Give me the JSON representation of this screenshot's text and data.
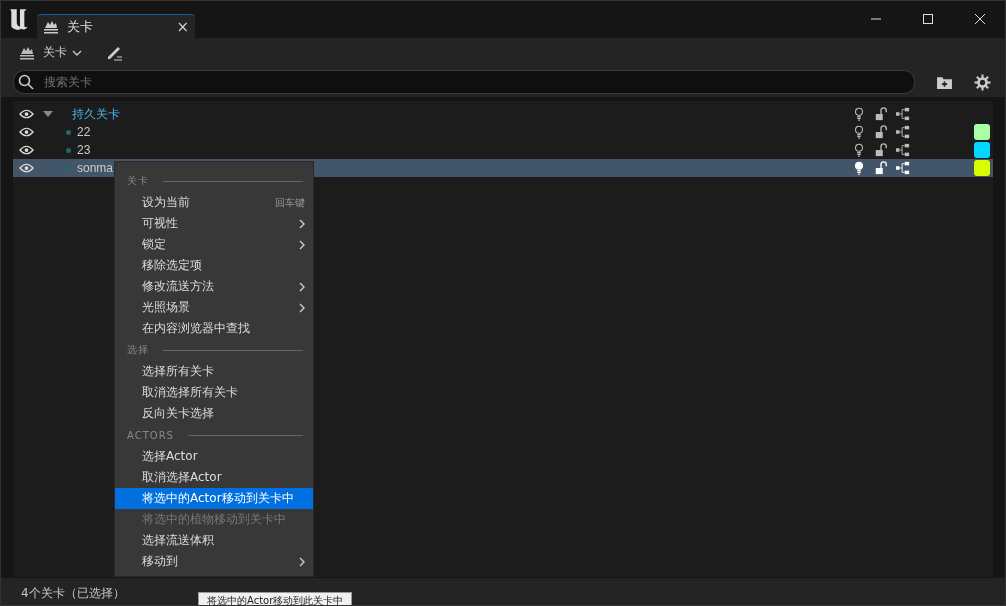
{
  "window": {
    "tab": {
      "title": "关卡",
      "close": "×"
    }
  },
  "toolbar": {
    "levels_button": "关卡"
  },
  "search": {
    "placeholder": "搜索关卡"
  },
  "levels": [
    {
      "name": "持久关卡",
      "visible": true,
      "expanded": true,
      "selected": false,
      "children": [
        {
          "name": "22",
          "visible": true,
          "selected": false,
          "color": "#a8ffa8"
        },
        {
          "name": "23",
          "visible": true,
          "selected": false,
          "color": "#00d8ff"
        },
        {
          "name": "sonma",
          "visible": true,
          "selected": true,
          "color": "#d8ff00"
        }
      ]
    }
  ],
  "context_menu": {
    "sections": [
      {
        "header": "关卡",
        "items": [
          {
            "label": "设为当前",
            "shortcut": "回车键",
            "submenu": false,
            "disabled": false,
            "selected": false
          },
          {
            "label": "可视性",
            "submenu": true,
            "disabled": false,
            "selected": false
          },
          {
            "label": "锁定",
            "submenu": true,
            "disabled": false,
            "selected": false
          },
          {
            "label": "移除选定项",
            "submenu": false,
            "disabled": false,
            "selected": false
          },
          {
            "label": "修改流送方法",
            "submenu": true,
            "disabled": false,
            "selected": false
          },
          {
            "label": "光照场景",
            "submenu": true,
            "disabled": false,
            "selected": false
          },
          {
            "label": "在内容浏览器中查找",
            "submenu": false,
            "disabled": false,
            "selected": false
          }
        ]
      },
      {
        "header": "选择",
        "items": [
          {
            "label": "选择所有关卡",
            "submenu": false,
            "disabled": false,
            "selected": false
          },
          {
            "label": "取消选择所有关卡",
            "submenu": false,
            "disabled": false,
            "selected": false
          },
          {
            "label": "反向关卡选择",
            "submenu": false,
            "disabled": false,
            "selected": false
          }
        ]
      },
      {
        "header": "ACTORS",
        "items": [
          {
            "label": "选择Actor",
            "submenu": false,
            "disabled": false,
            "selected": false
          },
          {
            "label": "取消选择Actor",
            "submenu": false,
            "disabled": false,
            "selected": false
          },
          {
            "label": "将选中的Actor移动到关卡中",
            "submenu": false,
            "disabled": false,
            "selected": true
          },
          {
            "label": "将选中的植物移动到关卡中",
            "submenu": false,
            "disabled": true,
            "selected": false
          },
          {
            "label": "选择流送体积",
            "submenu": false,
            "disabled": false,
            "selected": false
          },
          {
            "label": "移动到",
            "submenu": true,
            "disabled": false,
            "selected": false
          }
        ]
      }
    ]
  },
  "status_bar": "4个关卡（已选择）",
  "tooltip": "将选中的Actor移动到此关卡中"
}
